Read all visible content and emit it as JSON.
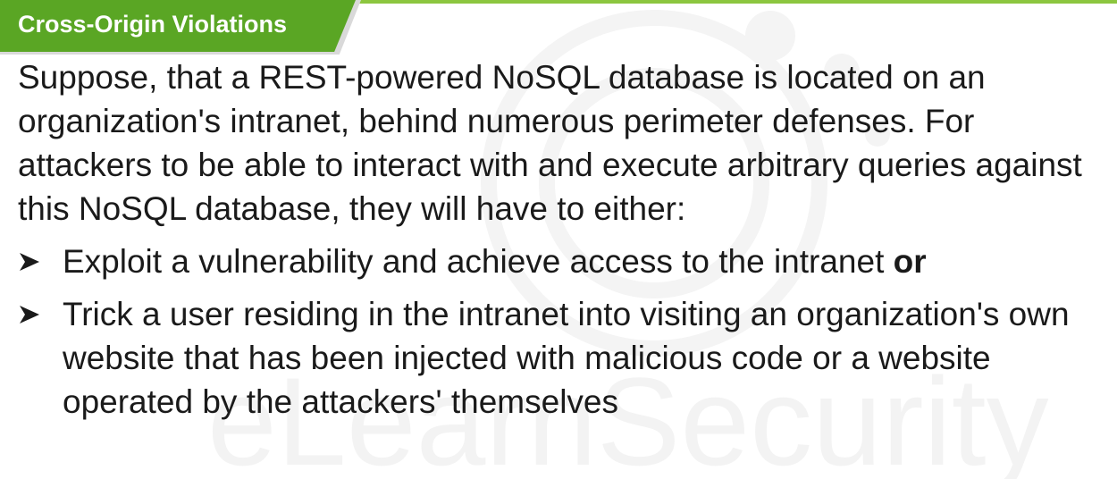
{
  "slide": {
    "title": "Cross-Origin Violations",
    "paragraph": "Suppose, that a REST-powered NoSQL database is located on an organization's intranet, behind numerous perimeter defenses. For attackers to be able to interact with and execute arbitrary queries against this NoSQL database, they will have to either:",
    "bullets": [
      {
        "text": "Exploit a vulnerability and achieve access to the intranet ",
        "bold_suffix": "or"
      },
      {
        "text": "Trick a user residing in the intranet into visiting an organization's own website that has been injected with malicious code or a website operated by the attackers' themselves",
        "bold_suffix": ""
      }
    ],
    "watermark": "eLearnSecurity"
  },
  "colors": {
    "accent": "#5aa624",
    "accent_light": "#8cc63f",
    "text": "#1a1a1a",
    "watermark": "#f3f3f3"
  },
  "icons": {
    "bullet": "right-arrow-bullet-icon",
    "watermark_logo": "elearnsecurity-logo-icon"
  }
}
